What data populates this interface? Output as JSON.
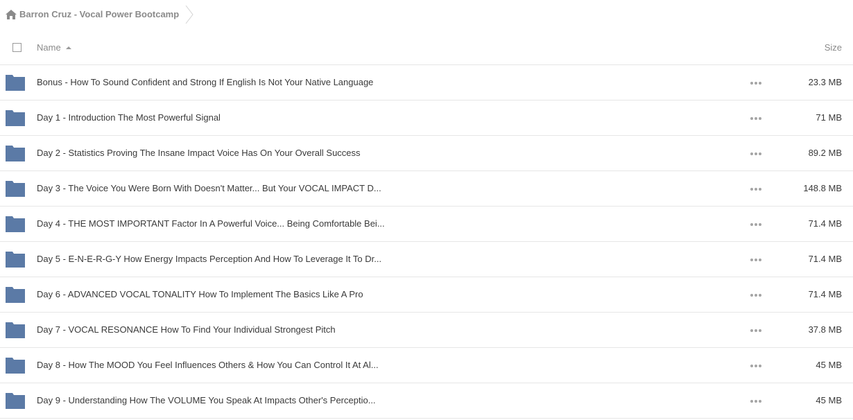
{
  "breadcrumb": {
    "home_icon": "home-icon",
    "current_folder": "Barron Cruz - Vocal Power Bootcamp"
  },
  "columns": {
    "name_label": "Name",
    "name_sort": "ascending",
    "size_label": "Size"
  },
  "colors": {
    "folder": "#5b7aa6",
    "muted_text": "#8a8a8a",
    "text": "#3a3a3a",
    "divider": "#e6e6e6"
  },
  "files": [
    {
      "name": "Bonus - How To Sound Confident and Strong If English Is Not Your Native Language",
      "size": "23.3 MB",
      "icon": "folder-icon"
    },
    {
      "name": "Day 1 - Introduction The Most Powerful Signal",
      "size": "71 MB",
      "icon": "folder-icon"
    },
    {
      "name": "Day 2 - Statistics Proving The Insane Impact Voice Has On Your Overall Success",
      "size": "89.2 MB",
      "icon": "folder-icon"
    },
    {
      "name": "Day 3 - The Voice You Were Born With Doesn't Matter... But Your VOCAL IMPACT D...",
      "size": "148.8 MB",
      "icon": "folder-icon"
    },
    {
      "name": "Day 4 - THE MOST IMPORTANT Factor In A Powerful Voice... Being Comfortable Bei...",
      "size": "71.4 MB",
      "icon": "folder-icon"
    },
    {
      "name": "Day 5 - E-N-E-R-G-Y How Energy Impacts Perception And How To Leverage It To Dr...",
      "size": "71.4 MB",
      "icon": "folder-icon"
    },
    {
      "name": "Day 6 - ADVANCED VOCAL TONALITY How To Implement The Basics Like A Pro",
      "size": "71.4 MB",
      "icon": "folder-icon"
    },
    {
      "name": "Day 7 - VOCAL RESONANCE How To Find Your Individual Strongest Pitch",
      "size": "37.8 MB",
      "icon": "folder-icon"
    },
    {
      "name": "Day 8 - How The MOOD You Feel Influences Others & How You Can Control It At Al...",
      "size": "45 MB",
      "icon": "folder-icon"
    },
    {
      "name": "Day 9 - Understanding How The VOLUME You Speak At Impacts Other's Perceptio...",
      "size": "45 MB",
      "icon": "folder-icon"
    }
  ]
}
